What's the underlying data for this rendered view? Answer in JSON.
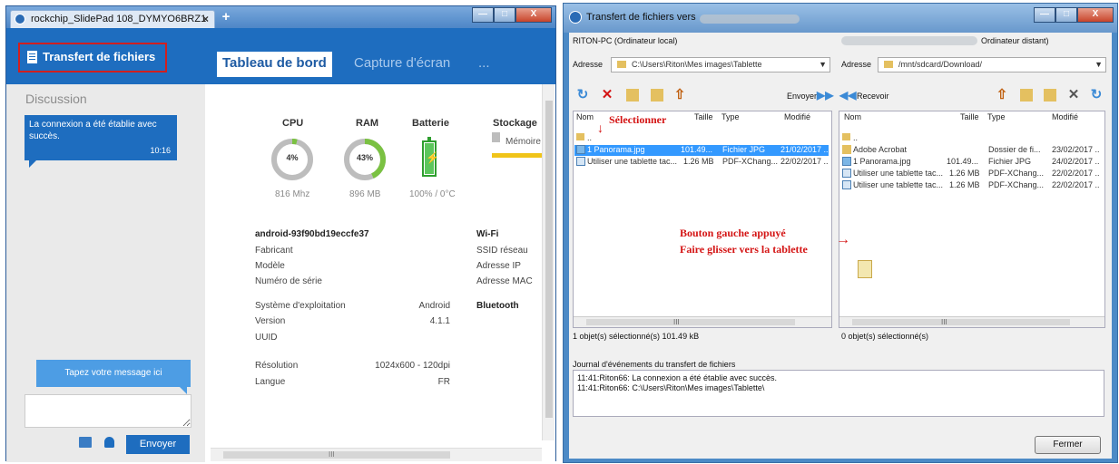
{
  "left_window": {
    "tab_title": "rockchip_SlidePad 108_DYMYO6BRZ1",
    "tab_close": "×",
    "new_tab": "+",
    "window_buttons": {
      "minimize": "—",
      "maximize": "□",
      "close": "X"
    },
    "transfer_label": "Transfert de fichiers",
    "nav_tabs": [
      "Tableau de bord",
      "Capture d'écran",
      "..."
    ],
    "chat": {
      "title": "Discussion",
      "message": "La connexion a été établie avec succès.",
      "time": "10:16",
      "placeholder": "Tapez votre message ici",
      "send_label": "Envoyer"
    },
    "stats": {
      "cpu": {
        "label": "CPU",
        "value": "4%",
        "sub": "816 Mhz",
        "percent": 4
      },
      "ram": {
        "label": "RAM",
        "value": "43%",
        "sub": "896 MB",
        "percent": 43
      },
      "battery": {
        "label": "Batterie",
        "sub": "100% / 0°C",
        "percent": 100
      },
      "storage": {
        "label": "Stockage",
        "memory_label": "Mémoire"
      }
    },
    "device": {
      "name": "android-93f90bd19eccfe37",
      "manufacturer_label": "Fabricant",
      "model_label": "Modèle",
      "serial_label": "Numéro de série",
      "os_label": "Système d'exploitation",
      "os_value": "Android",
      "version_label": "Version",
      "version_value": "4.1.1",
      "uuid_label": "UUID",
      "resolution_label": "Résolution",
      "resolution_value": "1024x600 - 120dpi",
      "language_label": "Langue",
      "language_value": "FR"
    },
    "wifi": {
      "title": "Wi-Fi",
      "ssid_label": "SSID réseau",
      "ip_label": "Adresse IP",
      "mac_label": "Adresse MAC"
    },
    "bluetooth": {
      "title": "Bluetooth"
    },
    "scrollbar_grip": "III"
  },
  "right_window": {
    "title": "Transfert de fichiers vers",
    "window_buttons": {
      "minimize": "—",
      "maximize": "□",
      "close": "X"
    },
    "local": {
      "header": "RITON-PC (Ordinateur local)",
      "address_label": "Adresse",
      "address": "C:\\Users\\Riton\\Mes images\\Tablette",
      "columns": [
        "Nom",
        "Taille",
        "Type",
        "Modifié"
      ],
      "rows": [
        {
          "name": "..",
          "size": "",
          "type": "",
          "modified": ""
        },
        {
          "name": "1 Panorama.jpg",
          "size": "101.49...",
          "type": "Fichier JPG",
          "modified": "21/02/2017 ..",
          "selected": true
        },
        {
          "name": "Utiliser une tablette tac...",
          "size": "1.26 MB",
          "type": "PDF-XChang...",
          "modified": "22/02/2017 .."
        }
      ],
      "send_label": "Envoyer",
      "status": "1 objet(s) sélectionné(s)  101.49 kB"
    },
    "remote": {
      "header": "Ordinateur distant)",
      "address_label": "Adresse",
      "address": "/mnt/sdcard/Download/",
      "columns": [
        "Nom",
        "Taille",
        "Type",
        "Modifié"
      ],
      "rows": [
        {
          "name": "..",
          "size": "",
          "type": "",
          "modified": ""
        },
        {
          "name": "Adobe Acrobat",
          "size": "",
          "type": "Dossier de fi...",
          "modified": "23/02/2017 .."
        },
        {
          "name": "1 Panorama.jpg",
          "size": "101.49...",
          "type": "Fichier JPG",
          "modified": "24/02/2017 .."
        },
        {
          "name": "Utiliser une tablette tac...",
          "size": "1.26 MB",
          "type": "PDF-XChang...",
          "modified": "22/02/2017 .."
        },
        {
          "name": "Utiliser une tablette tac...",
          "size": "1.26 MB",
          "type": "PDF-XChang...",
          "modified": "22/02/2017 .."
        }
      ],
      "receive_label": "Recevoir",
      "status": "0 objet(s) sélectionné(s)"
    },
    "annotations": {
      "select": "Sélectionner",
      "drag_line1": "Bouton gauche appuyé",
      "drag_line2": "Faire glisser vers la tablette"
    },
    "log": {
      "title": "Journal d'événements du transfert de fichiers",
      "lines": [
        "11:41:Riton66: La connexion a été établie avec succès.",
        "11:41:Riton66: C:\\Users\\Riton\\Mes images\\Tablette\\"
      ]
    },
    "close_button": "Fermer",
    "scrollbar_grip": "III"
  },
  "colors": {
    "blue_accent": "#1e6dbf",
    "cpu_ring": "#bdbdbd",
    "ram_ring": "#7ac142",
    "battery": "#2e9e2e",
    "storage_bar": "#f0c419",
    "annotation_red": "#d41414",
    "selection": "#3399ff"
  }
}
